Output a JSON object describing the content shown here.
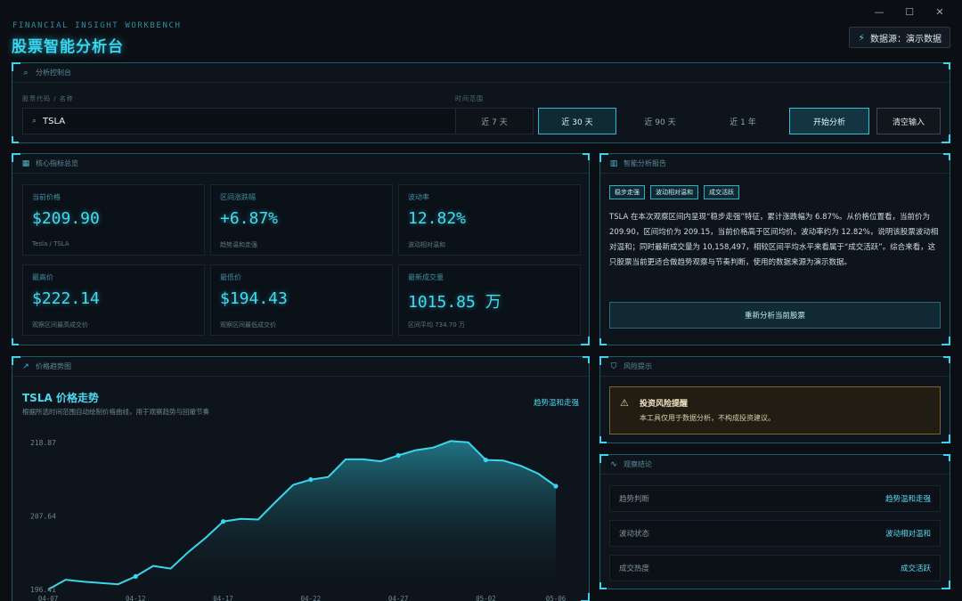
{
  "header": {
    "subtitle_en": "FINANCIAL INSIGHT WORKBENCH",
    "title": "股票智能分析台",
    "window_controls": [
      "—",
      "☐",
      "✕"
    ],
    "datasource_label": "数据源：演示数据"
  },
  "control": {
    "title": "分析控制台",
    "code_label": "股票代码 / 名称",
    "range_label": "时间范围",
    "search_value": "TSLA",
    "ranges": [
      "近 7 天",
      "近 30 天",
      "近 90 天",
      "近 1 年"
    ],
    "active_range": "近 30 天",
    "start_label": "开始分析",
    "clear_label": "清空输入"
  },
  "metrics": {
    "title": "核心指标总览",
    "items": [
      {
        "label": "当前价格",
        "value": "$209.90",
        "sub": "Tesla / TSLA"
      },
      {
        "label": "区间涨跌幅",
        "value": "+6.87%",
        "sub": "趋势温和走强"
      },
      {
        "label": "波动率",
        "value": "12.82%",
        "sub": "波动相对温和"
      },
      {
        "label": "最高价",
        "value": "$222.14",
        "sub": "观察区间最高成交价"
      },
      {
        "label": "最低价",
        "value": "$194.43",
        "sub": "观察区间最低成交价"
      },
      {
        "label": "最新成交量",
        "value": "1015.85 万",
        "sub": "区间平均 734.70 万"
      }
    ]
  },
  "analysis": {
    "title": "智能分析报告",
    "tags": [
      "稳步走强",
      "波动相对温和",
      "成交活跃"
    ],
    "text": "TSLA 在本次观察区间内呈现“稳步走强”特征，累计涨跌幅为 6.87%。从价格位置看，当前价为 209.90，区间均价为 209.15，当前价格高于区间均价。波动率约为 12.82%，说明该股票波动相对温和；同时最新成交量为 10,158,497，相较区间平均水平来看属于“成交活跃”。综合来看，这只股票当前更适合做趋势观察与节奏判断，使用的数据来源为演示数据。",
    "button": "重新分析当前股票"
  },
  "chart_panel": {
    "title": "价格趋势图",
    "chart_title": "TSLA 价格走势",
    "chart_sub": "根据所选时间范围自动绘制价格曲线，用于观察趋势与回撤节奏",
    "badge": "趋势温和走强"
  },
  "risk": {
    "title": "风险提示",
    "box_title": "投资风险提醒",
    "box_text": "本工具仅用于数据分析，不构成投资建议。"
  },
  "conclusion": {
    "title": "观察结论",
    "rows": [
      {
        "k": "趋势判断",
        "v": "趋势温和走强"
      },
      {
        "k": "波动状态",
        "v": "波动相对温和"
      },
      {
        "k": "成交热度",
        "v": "成交活跃"
      }
    ]
  },
  "chart_data": {
    "type": "area",
    "title": "TSLA 价格走势",
    "y_ticks": [
      "218.87",
      "207.64",
      "196.41"
    ],
    "ylim": [
      196.41,
      218.87
    ],
    "x_ticks": [
      "04-07",
      "04-12",
      "04-17",
      "04-22",
      "04-27",
      "05-02",
      "05-06"
    ],
    "x": [
      "04-07",
      "04-08",
      "04-09",
      "04-10",
      "04-11",
      "04-12",
      "04-13",
      "04-14",
      "04-15",
      "04-16",
      "04-17",
      "04-18",
      "04-19",
      "04-20",
      "04-21",
      "04-22",
      "04-23",
      "04-24",
      "04-25",
      "04-26",
      "04-27",
      "04-28",
      "04-29",
      "04-30",
      "05-01",
      "05-02",
      "05-03",
      "05-04",
      "05-05",
      "05-06"
    ],
    "values": [
      196.4,
      197.9,
      197.6,
      197.4,
      197.2,
      198.4,
      200.0,
      199.6,
      202.1,
      204.3,
      206.8,
      207.2,
      207.1,
      209.8,
      212.4,
      213.2,
      213.6,
      216.3,
      216.3,
      216.0,
      216.9,
      217.7,
      218.1,
      219.1,
      218.9,
      216.2,
      216.1,
      215.3,
      214.1,
      212.2
    ],
    "marked": [
      5,
      10,
      15,
      20,
      25,
      29
    ],
    "series_color": "#3ad6ee",
    "grid": false
  }
}
